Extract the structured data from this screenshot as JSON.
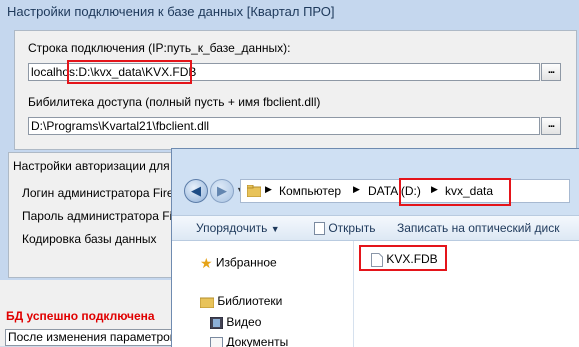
{
  "dialog": {
    "title": "Настройки подключения к базе данных [Квартал ПРО]",
    "conn_label": "Строка подключения (IP:путь_к_базе_данных):",
    "conn_value_prefix": "localhos",
    "conn_value_highlight": ":D:\\kvx_data\\KVX.FDB",
    "lib_label": "Бибилитека доступа (полный пусть + имя fbclient.dll)",
    "lib_value": "D:\\Programs\\Kvartal21\\fbclient.dll",
    "browse_label": "...",
    "auth_group_title": "Настройки авторизации для F",
    "auth_login_label": "Логин администратора Firebi",
    "auth_password_label": "Пароль администратора Fireb",
    "auth_encoding_label": "Кодировка базы данных",
    "status_text": "БД успешно подключена",
    "note_text": "После изменения параметров"
  },
  "explorer": {
    "breadcrumb": [
      "Компьютер",
      "DATA (D:)",
      "kvx_data"
    ],
    "toolbar": {
      "organize": "Упорядочить",
      "open": "Открыть",
      "burn": "Записать на оптический диск"
    },
    "nav": {
      "favorites": "Избранное",
      "libraries": "Библиотеки",
      "video": "Видео",
      "documents": "Документы"
    },
    "file": "KVX.FDB"
  },
  "colors": {
    "highlight": "#e4141a",
    "status_red": "#e00000",
    "window_blue": "#c5d7ee"
  }
}
